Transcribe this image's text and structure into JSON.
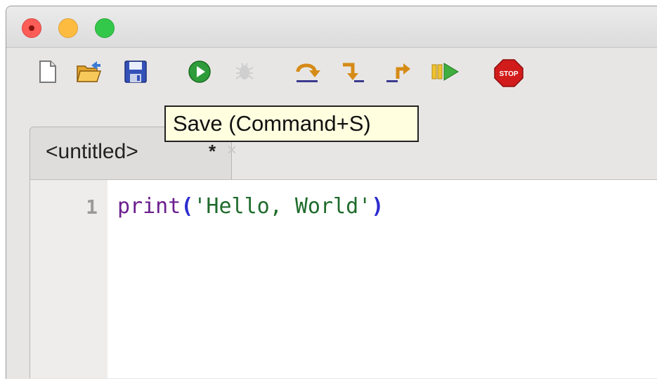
{
  "window": {
    "traffic_lights": [
      "close",
      "minimize",
      "zoom"
    ]
  },
  "toolbar": {
    "buttons": [
      {
        "name": "new-file",
        "icon": "new-document-icon"
      },
      {
        "name": "open-file",
        "icon": "open-folder-icon"
      },
      {
        "name": "save-file",
        "icon": "floppy-disk-icon"
      },
      {
        "name": "run",
        "icon": "play-circle-icon"
      },
      {
        "name": "debug",
        "icon": "bug-icon",
        "disabled": true
      },
      {
        "name": "step-over",
        "icon": "step-over-icon"
      },
      {
        "name": "step-into",
        "icon": "step-into-icon"
      },
      {
        "name": "step-out",
        "icon": "step-out-icon"
      },
      {
        "name": "resume",
        "icon": "resume-icon"
      },
      {
        "name": "stop",
        "icon": "stop-sign-icon",
        "label": "STOP"
      }
    ],
    "tooltip": "Save (Command+S)"
  },
  "tabs": [
    {
      "label": "<untitled>",
      "modified_marker": "*",
      "close_glyph": "×"
    }
  ],
  "editor": {
    "lines": [
      {
        "number": "1",
        "tokens": {
          "fn": "print",
          "open": "(",
          "str": "'Hello, World'",
          "close": ")"
        }
      }
    ]
  },
  "colors": {
    "keyword": "#6c1f8e",
    "paren": "#2b2bd0",
    "string": "#1f6b2c",
    "tooltip_bg": "#ffffe0"
  }
}
